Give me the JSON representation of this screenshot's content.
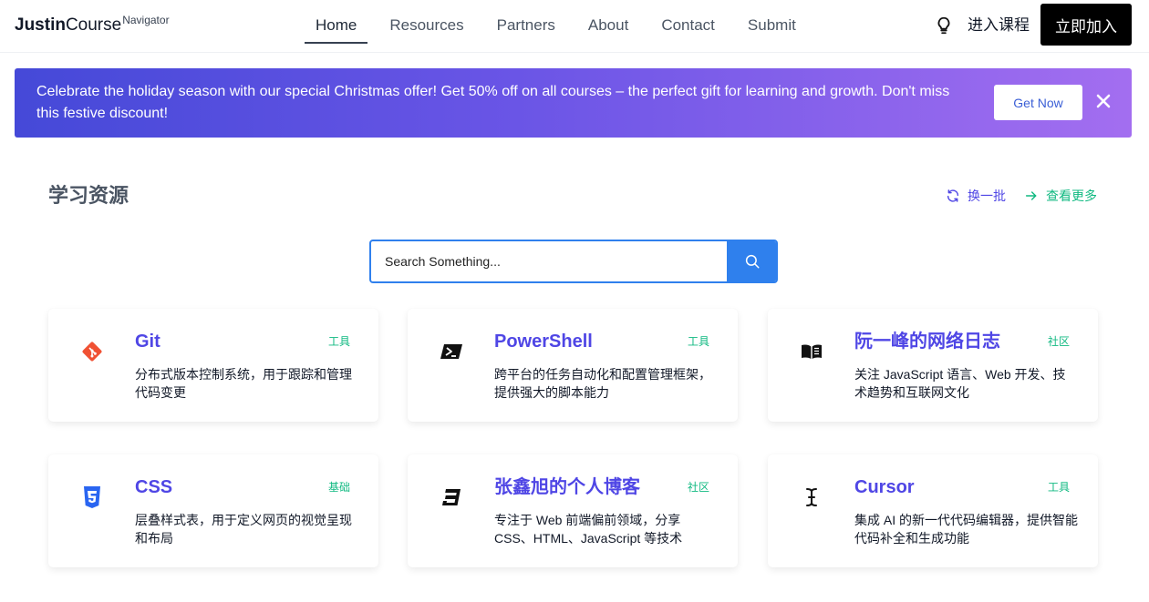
{
  "header": {
    "logo": {
      "part1": "Justin",
      "part2": "Course",
      "sup": "Navigator"
    },
    "nav": [
      {
        "label": "Home",
        "active": true
      },
      {
        "label": "Resources",
        "active": false
      },
      {
        "label": "Partners",
        "active": false
      },
      {
        "label": "About",
        "active": false
      },
      {
        "label": "Contact",
        "active": false
      },
      {
        "label": "Submit",
        "active": false
      }
    ],
    "theme_icon": "lightbulb-icon",
    "enter_label": "进入课程",
    "join_label": "立即加入"
  },
  "banner": {
    "text": "Celebrate the holiday season with our special Christmas offer! Get 50% off on all courses – the perfect gift for learning and growth. Don't miss this festive discount!",
    "button_label": "Get Now",
    "close_icon": "close-icon",
    "gradient": [
      "#4549d8",
      "#a36ef0"
    ]
  },
  "section": {
    "title": "学习资源",
    "refresh_label": "换一批",
    "more_label": "查看更多"
  },
  "search": {
    "placeholder": "Search Something...",
    "button_icon": "search-icon"
  },
  "cards": [
    {
      "title": "Git",
      "tag": "工具",
      "desc": "分布式版本控制系统，用于跟踪和管理代码变更",
      "icon": "git-icon"
    },
    {
      "title": "PowerShell",
      "tag": "工具",
      "desc": "跨平台的任务自动化和配置管理框架，提供强大的脚本能力",
      "icon": "powershell-icon"
    },
    {
      "title": "阮一峰的网络日志",
      "tag": "社区",
      "desc": "关注 JavaScript 语言、Web 开发、技术趋势和互联网文化",
      "icon": "book-icon"
    },
    {
      "title": "CSS",
      "tag": "基础",
      "desc": "层叠样式表，用于定义网页的视觉呈现和布局",
      "icon": "css3-icon"
    },
    {
      "title": "张鑫旭的个人博客",
      "tag": "社区",
      "desc": "专注于 Web 前端偏前领域，分享 CSS、HTML、JavaScript 等技术",
      "icon": "css3-alt-icon"
    },
    {
      "title": "Cursor",
      "tag": "工具",
      "desc": "集成 AI 的新一代代码编辑器，提供智能代码补全和生成功能",
      "icon": "text-cursor-icon"
    }
  ],
  "colors": {
    "accent": "#4f46e5",
    "tag": "#10b981",
    "search_blue": "#2f80ed",
    "git": "#f05133",
    "css_blue": "#2965f1"
  }
}
